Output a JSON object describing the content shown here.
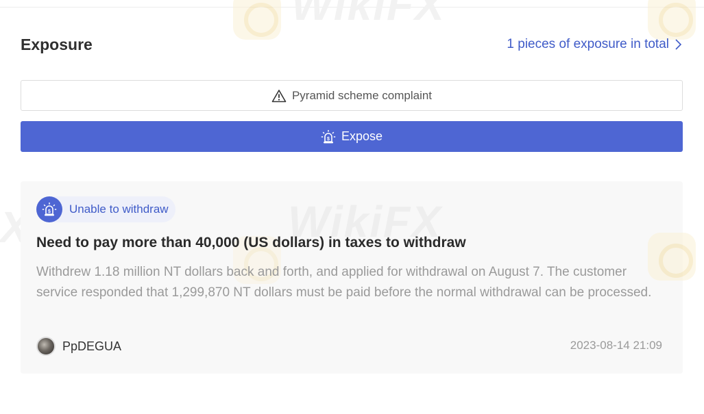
{
  "section": {
    "title": "Exposure",
    "total_link": "1 pieces of exposure in total"
  },
  "buttons": {
    "complaint_label": "Pyramid scheme complaint",
    "expose_label": "Expose"
  },
  "exposure_item": {
    "tag": "Unable to withdraw",
    "title": "Need to pay more than 40,000 (US dollars) in taxes to withdraw",
    "description": "Withdrew 1.18 million NT dollars back and forth, and applied for withdrawal on August 7. The customer service responded that 1,299,870 NT dollars must be paid before the normal withdrawal can be processed.",
    "author": "PpDEGUA",
    "date": "2023-08-14 21:09"
  },
  "icons": {
    "total_link": "chevron-right-icon",
    "complaint": "warning-triangle-icon",
    "expose": "alarm-siren-icon",
    "tag": "alarm-siren-icon"
  },
  "colors": {
    "accent": "#4e66d3",
    "link": "#3f5bc8",
    "card_bg": "#f8f8f8",
    "tag_bg": "#eef0fa",
    "muted_text": "#9a9a9a"
  }
}
